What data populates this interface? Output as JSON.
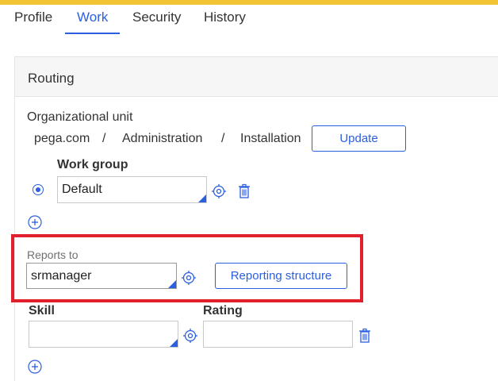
{
  "tabs": [
    {
      "label": "Profile"
    },
    {
      "label": "Work"
    },
    {
      "label": "Security"
    },
    {
      "label": "History"
    }
  ],
  "active_tab": "Work",
  "routing": {
    "title": "Routing",
    "org_unit_label": "Organizational unit",
    "org_path": [
      "pega.com",
      "Administration",
      "Installation"
    ],
    "separator": "/",
    "update_button": "Update",
    "work_group_label": "Work group",
    "work_group_value": "Default",
    "reports_to_label": "Reports to",
    "reports_to_value": "srmanager",
    "reporting_structure_button": "Reporting structure",
    "skill_label": "Skill",
    "rating_label": "Rating",
    "skill_value": "",
    "rating_value": ""
  },
  "colors": {
    "accent": "#2b5fe0",
    "top_bar": "#f3c433",
    "highlight": "#e0202d"
  },
  "icons": [
    "target-icon",
    "trash-icon",
    "plus-circle-icon"
  ]
}
